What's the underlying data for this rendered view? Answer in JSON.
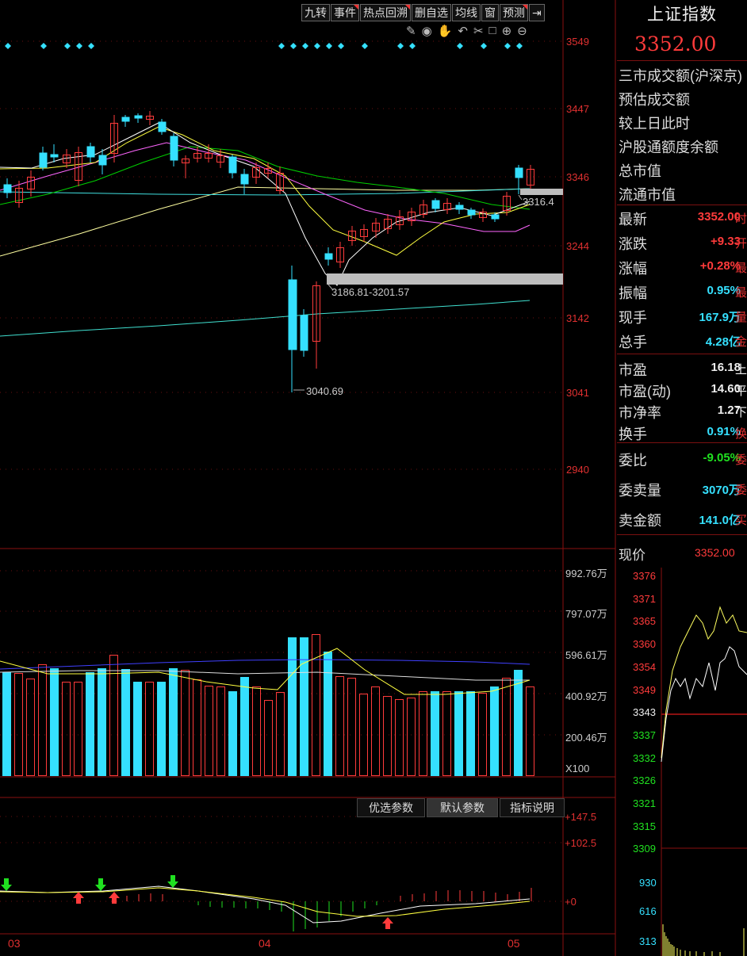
{
  "toolbar": {
    "buttons": [
      {
        "label": "九转",
        "flag": false
      },
      {
        "label": "事件",
        "flag": true
      },
      {
        "label": "热点回溯",
        "flag": true
      },
      {
        "label": "删自选",
        "flag": false
      },
      {
        "label": "均线",
        "flag": false
      },
      {
        "label": "窗",
        "flag": false
      },
      {
        "label": "预测",
        "flag": true
      }
    ],
    "tools": [
      "pencil-icon",
      "eye-icon",
      "hand-icon",
      "undo-icon",
      "scissors-icon",
      "lock-icon",
      "zoom-in-icon",
      "zoom-out-icon"
    ]
  },
  "price_axis": [
    "3549",
    "3447",
    "3346",
    "3244",
    "3142",
    "3041",
    "2940"
  ],
  "annotations": {
    "last": "3316.4",
    "gap": "3186.81-3201.57",
    "low": "3040.69"
  },
  "volume_axis": [
    "992.76万",
    "797.07万",
    "596.61万",
    "400.92万",
    "200.46万",
    "X100"
  ],
  "indicator": {
    "tabs": [
      "优选参数",
      "默认参数",
      "指标说明"
    ],
    "active_tab": "默认参数",
    "axis": [
      "+147.5",
      "+102.5",
      "+0"
    ]
  },
  "date_axis": [
    "03",
    "04",
    "05"
  ],
  "sidebar": {
    "title": "上证指数",
    "price": "3352.00",
    "info_rows": [
      "三市成交额(沪深京)",
      "预估成交额",
      "较上日此时",
      "沪股通额度余额",
      "总市值",
      "流通市值"
    ],
    "quote_rows": [
      {
        "label": "最新",
        "value": "3352.00",
        "unit": "时",
        "color": "red"
      },
      {
        "label": "涨跌",
        "value": "+9.33",
        "unit": "开",
        "color": "red"
      },
      {
        "label": "涨幅",
        "value": "+0.28%",
        "unit": "最",
        "color": "red"
      },
      {
        "label": "振幅",
        "value": "0.95%",
        "unit": "最",
        "color": "cyan"
      },
      {
        "label": "现手",
        "value": "167.9万",
        "unit": "量",
        "color": "cyan"
      },
      {
        "label": "总手",
        "value": "4.28亿",
        "unit": "金",
        "color": "cyan"
      }
    ],
    "valuation_rows": [
      {
        "label": "市盈",
        "value": "16.18",
        "unit": "上",
        "color": "white"
      },
      {
        "label": "市盈(动)",
        "value": "14.60",
        "unit": "平",
        "color": "white"
      },
      {
        "label": "市净率",
        "value": "1.27",
        "unit": "下",
        "color": "white"
      },
      {
        "label": "换手",
        "value": "0.91%",
        "unit": "换",
        "color": "cyan"
      }
    ],
    "order_rows": [
      {
        "label": "委比",
        "value": "-9.05%",
        "unit": "委",
        "color": "green"
      },
      {
        "label": "委卖量",
        "value": "3070万",
        "unit": "委",
        "color": "cyan"
      },
      {
        "label": "卖金额",
        "value": "141.0亿",
        "unit": "买",
        "color": "cyan"
      }
    ],
    "mini": {
      "label": "现价",
      "price": "3352.00",
      "price_axis": [
        "3376",
        "3371",
        "3365",
        "3360",
        "3354",
        "3349",
        "3343",
        "3337",
        "3332",
        "3326",
        "3321",
        "3315",
        "3309"
      ],
      "vol_axis": [
        "930",
        "616",
        "313"
      ]
    }
  },
  "colors": {
    "up": "#ff3b3b",
    "down": "#35e0ff",
    "ma5": "#ffffff",
    "ma10": "#ffff40",
    "ma20": "#ff66ff",
    "ma30": "#00d000",
    "ma60": "#ffffa0",
    "ma120": "#40e0d0"
  }
}
